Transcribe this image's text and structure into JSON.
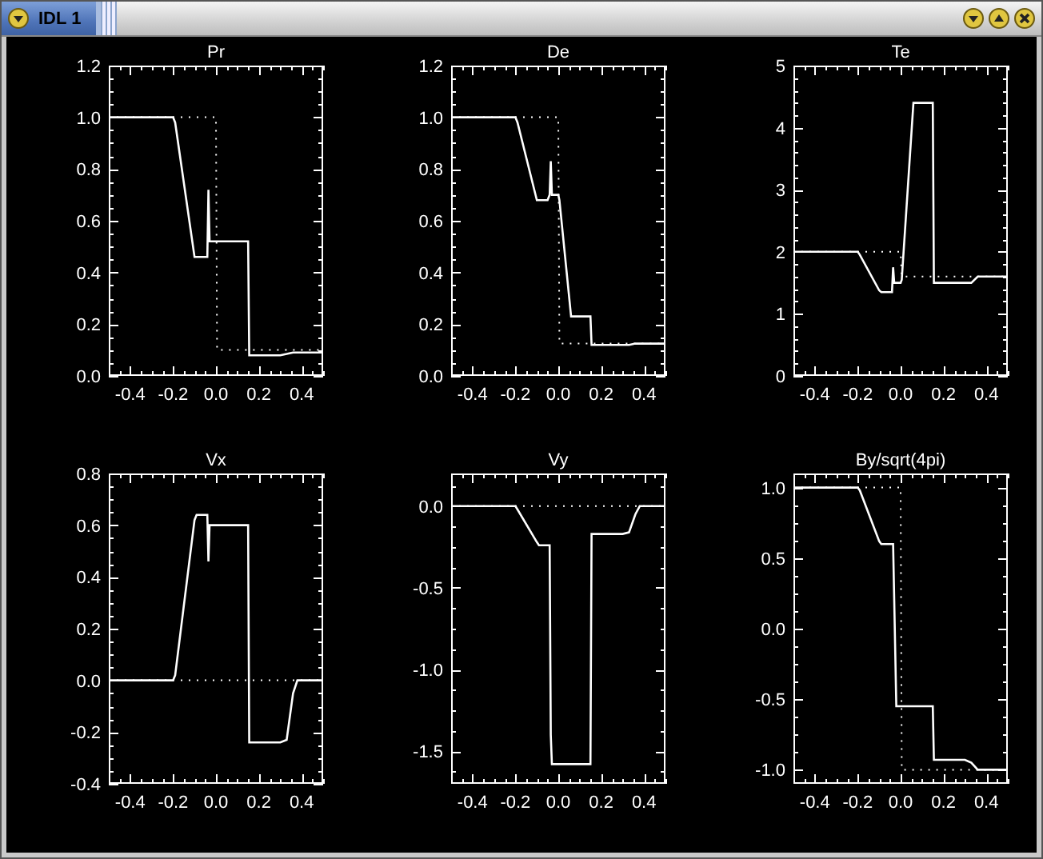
{
  "window": {
    "title": "IDL 1"
  },
  "plots": [
    {
      "chart_data": {
        "type": "line",
        "title": "Pr",
        "x": [
          -0.5,
          -0.2,
          -0.19,
          -0.1,
          -0.09,
          -0.05,
          -0.04,
          -0.035,
          -0.03,
          -0.02,
          0,
          0.005,
          0.06,
          0.07,
          0.15,
          0.155,
          0.3,
          0.33,
          0.36,
          0.38,
          0.5
        ],
        "series": [
          {
            "line_style": "dotted",
            "color": "#ffffff",
            "values": [
              1,
              1,
              1,
              1,
              1,
              1,
              1,
              1,
              1,
              1,
              1,
              0.1,
              0.1,
              0.1,
              0.1,
              0.1,
              0.1,
              0.1,
              0.1,
              0.1,
              0.1
            ]
          },
          {
            "color": "#ffffff",
            "values": [
              1,
              1,
              0.98,
              0.46,
              0.46,
              0.46,
              0.46,
              0.72,
              0.52,
              0.52,
              0.52,
              0.52,
              0.52,
              0.52,
              0.52,
              0.08,
              0.08,
              0.085,
              0.09,
              0.09,
              0.09
            ]
          }
        ],
        "xlim": [
          -0.5,
          0.5
        ],
        "ylim": [
          0,
          1.2
        ],
        "xticks": [
          {
            "value": -0.4,
            "label": "-0.4"
          },
          {
            "value": -0.2,
            "label": "-0.2"
          },
          {
            "value": 0,
            "label": "0.0"
          },
          {
            "value": 0.2,
            "label": "0.2"
          },
          {
            "value": 0.4,
            "label": "0.4"
          }
        ],
        "yticks": [
          {
            "value": 0,
            "label": "0.0"
          },
          {
            "value": 0.2,
            "label": "0.2"
          },
          {
            "value": 0.4,
            "label": "0.4"
          },
          {
            "value": 0.6,
            "label": "0.6"
          },
          {
            "value": 0.8,
            "label": "0.8"
          },
          {
            "value": 1,
            "label": "1.0"
          },
          {
            "value": 1.2,
            "label": "1.2"
          }
        ]
      }
    },
    {
      "chart_data": {
        "type": "line",
        "title": "De",
        "x": [
          -0.5,
          -0.2,
          -0.19,
          -0.1,
          -0.09,
          -0.05,
          -0.04,
          -0.035,
          -0.03,
          -0.02,
          0,
          0.005,
          0.06,
          0.07,
          0.15,
          0.155,
          0.3,
          0.33,
          0.36,
          0.38,
          0.5
        ],
        "series": [
          {
            "line_style": "dotted",
            "color": "#ffffff",
            "values": [
              1,
              1,
              1,
              1,
              1,
              1,
              1,
              1,
              1,
              1,
              1,
              0.125,
              0.125,
              0.125,
              0.125,
              0.125,
              0.125,
              0.125,
              0.125,
              0.125,
              0.125
            ]
          },
          {
            "color": "#ffffff",
            "values": [
              1,
              1,
              0.98,
              0.68,
              0.68,
              0.68,
              0.7,
              0.83,
              0.7,
              0.7,
              0.7,
              0.68,
              0.23,
              0.23,
              0.23,
              0.12,
              0.12,
              0.12,
              0.125,
              0.125,
              0.125
            ]
          }
        ],
        "xlim": [
          -0.5,
          0.5
        ],
        "ylim": [
          0,
          1.2
        ],
        "xticks": [
          {
            "value": -0.4,
            "label": "-0.4"
          },
          {
            "value": -0.2,
            "label": "-0.2"
          },
          {
            "value": 0,
            "label": "0.0"
          },
          {
            "value": 0.2,
            "label": "0.2"
          },
          {
            "value": 0.4,
            "label": "0.4"
          }
        ],
        "yticks": [
          {
            "value": 0,
            "label": "0.0"
          },
          {
            "value": 0.2,
            "label": "0.2"
          },
          {
            "value": 0.4,
            "label": "0.4"
          },
          {
            "value": 0.6,
            "label": "0.6"
          },
          {
            "value": 0.8,
            "label": "0.8"
          },
          {
            "value": 1,
            "label": "1.0"
          },
          {
            "value": 1.2,
            "label": "1.2"
          }
        ]
      }
    },
    {
      "chart_data": {
        "type": "line",
        "title": "Te",
        "x": [
          -0.5,
          -0.2,
          -0.19,
          -0.1,
          -0.09,
          -0.05,
          -0.04,
          -0.035,
          -0.03,
          -0.02,
          0,
          0.005,
          0.06,
          0.07,
          0.15,
          0.155,
          0.3,
          0.33,
          0.36,
          0.38,
          0.5
        ],
        "series": [
          {
            "line_style": "dotted",
            "color": "#ffffff",
            "values": [
              2,
              2,
              2,
              2,
              2,
              2,
              2,
              2,
              2,
              2,
              2,
              1.6,
              1.6,
              1.6,
              1.6,
              1.6,
              1.6,
              1.6,
              1.6,
              1.6,
              1.6
            ]
          },
          {
            "color": "#ffffff",
            "values": [
              2,
              2,
              1.95,
              1.38,
              1.35,
              1.35,
              1.35,
              1.75,
              1.5,
              1.5,
              1.5,
              1.55,
              4.4,
              4.4,
              4.4,
              1.5,
              1.5,
              1.5,
              1.6,
              1.6,
              1.6
            ]
          }
        ],
        "xlim": [
          -0.5,
          0.5
        ],
        "ylim": [
          0,
          5
        ],
        "xticks": [
          {
            "value": -0.4,
            "label": "-0.4"
          },
          {
            "value": -0.2,
            "label": "-0.2"
          },
          {
            "value": 0,
            "label": "0.0"
          },
          {
            "value": 0.2,
            "label": "0.2"
          },
          {
            "value": 0.4,
            "label": "0.4"
          }
        ],
        "yticks": [
          0,
          1,
          2,
          3,
          4,
          5
        ]
      }
    },
    {
      "chart_data": {
        "type": "line",
        "title": "Vx",
        "x": [
          -0.5,
          -0.2,
          -0.19,
          -0.1,
          -0.09,
          -0.05,
          -0.04,
          -0.035,
          -0.03,
          -0.02,
          0,
          0.005,
          0.06,
          0.07,
          0.15,
          0.155,
          0.3,
          0.33,
          0.36,
          0.38,
          0.5
        ],
        "series": [
          {
            "line_style": "dotted",
            "color": "#ffffff",
            "values": [
              0,
              0,
              0,
              0,
              0,
              0,
              0,
              0,
              0,
              0,
              0,
              0,
              0,
              0,
              0,
              0,
              0,
              0,
              0,
              0,
              0
            ]
          },
          {
            "color": "#ffffff",
            "values": [
              0,
              0,
              0.02,
              0.62,
              0.64,
              0.64,
              0.64,
              0.46,
              0.6,
              0.6,
              0.6,
              0.6,
              0.6,
              0.6,
              0.6,
              -0.24,
              -0.24,
              -0.23,
              -0.05,
              0,
              0
            ]
          }
        ],
        "xlim": [
          -0.5,
          0.5
        ],
        "ylim": [
          -0.4,
          0.8
        ],
        "xticks": [
          {
            "value": -0.4,
            "label": "-0.4"
          },
          {
            "value": -0.2,
            "label": "-0.2"
          },
          {
            "value": 0,
            "label": "0.0"
          },
          {
            "value": 0.2,
            "label": "0.2"
          },
          {
            "value": 0.4,
            "label": "0.4"
          }
        ],
        "yticks": [
          {
            "value": -0.4,
            "label": "-0.4"
          },
          {
            "value": -0.2,
            "label": "-0.2"
          },
          {
            "value": 0,
            "label": "0.0"
          },
          {
            "value": 0.2,
            "label": "0.2"
          },
          {
            "value": 0.4,
            "label": "0.4"
          },
          {
            "value": 0.6,
            "label": "0.6"
          },
          {
            "value": 0.8,
            "label": "0.8"
          }
        ]
      }
    },
    {
      "chart_data": {
        "type": "line",
        "title": "Vy",
        "x": [
          -0.5,
          -0.2,
          -0.19,
          -0.1,
          -0.09,
          -0.05,
          -0.04,
          -0.035,
          -0.03,
          -0.02,
          0,
          0.005,
          0.06,
          0.07,
          0.15,
          0.155,
          0.3,
          0.33,
          0.36,
          0.38,
          0.5
        ],
        "series": [
          {
            "line_style": "dotted",
            "color": "#ffffff",
            "values": [
              0,
              0,
              0,
              0,
              0,
              0,
              0,
              0,
              0,
              0,
              0,
              0,
              0,
              0,
              0,
              0,
              0,
              0,
              0,
              0,
              0
            ]
          },
          {
            "color": "#ffffff",
            "values": [
              0,
              0,
              -0.02,
              -0.22,
              -0.24,
              -0.24,
              -0.24,
              -1.4,
              -1.58,
              -1.58,
              -1.58,
              -1.58,
              -1.58,
              -1.58,
              -1.58,
              -0.17,
              -0.17,
              -0.16,
              -0.05,
              0,
              0
            ]
          }
        ],
        "xlim": [
          -0.5,
          0.5
        ],
        "ylim": [
          -1.7,
          0.2
        ],
        "xticks": [
          {
            "value": -0.4,
            "label": "-0.4"
          },
          {
            "value": -0.2,
            "label": "-0.2"
          },
          {
            "value": 0,
            "label": "0.0"
          },
          {
            "value": 0.2,
            "label": "0.2"
          },
          {
            "value": 0.4,
            "label": "0.4"
          }
        ],
        "yticks": [
          {
            "value": -1.5,
            "label": "-1.5"
          },
          {
            "value": -1,
            "label": "-1.0"
          },
          {
            "value": -0.5,
            "label": "-0.5"
          },
          {
            "value": 0,
            "label": "0.0"
          }
        ]
      }
    },
    {
      "chart_data": {
        "type": "line",
        "title": "By/sqrt(4pi)",
        "x": [
          -0.5,
          -0.2,
          -0.19,
          -0.1,
          -0.09,
          -0.05,
          -0.04,
          -0.035,
          -0.03,
          -0.02,
          0,
          0.005,
          0.06,
          0.07,
          0.15,
          0.155,
          0.3,
          0.33,
          0.36,
          0.38,
          0.5
        ],
        "series": [
          {
            "line_style": "dotted",
            "color": "#ffffff",
            "values": [
              1,
              1,
              1,
              1,
              1,
              1,
              1,
              1,
              1,
              1,
              1,
              -1,
              -1,
              -1,
              -1,
              -1,
              -1,
              -1,
              -1,
              -1,
              -1
            ]
          },
          {
            "color": "#ffffff",
            "values": [
              1,
              1,
              0.98,
              0.62,
              0.6,
              0.6,
              0.6,
              0.6,
              0.2,
              -0.55,
              -0.55,
              -0.55,
              -0.55,
              -0.55,
              -0.55,
              -0.93,
              -0.93,
              -0.95,
              -1,
              -1,
              -1
            ]
          }
        ],
        "xlim": [
          -0.5,
          0.5
        ],
        "ylim": [
          -1.1,
          1.1
        ],
        "xticks": [
          {
            "value": -0.4,
            "label": "-0.4"
          },
          {
            "value": -0.2,
            "label": "-0.2"
          },
          {
            "value": 0,
            "label": "0.0"
          },
          {
            "value": 0.2,
            "label": "0.2"
          },
          {
            "value": 0.4,
            "label": "0.4"
          }
        ],
        "yticks": [
          {
            "value": -1,
            "label": "-1.0"
          },
          {
            "value": -0.5,
            "label": "-0.5"
          },
          {
            "value": 0,
            "label": "0.0"
          },
          {
            "value": 0.5,
            "label": "0.5"
          },
          {
            "value": 1,
            "label": "1.0"
          }
        ]
      }
    }
  ]
}
